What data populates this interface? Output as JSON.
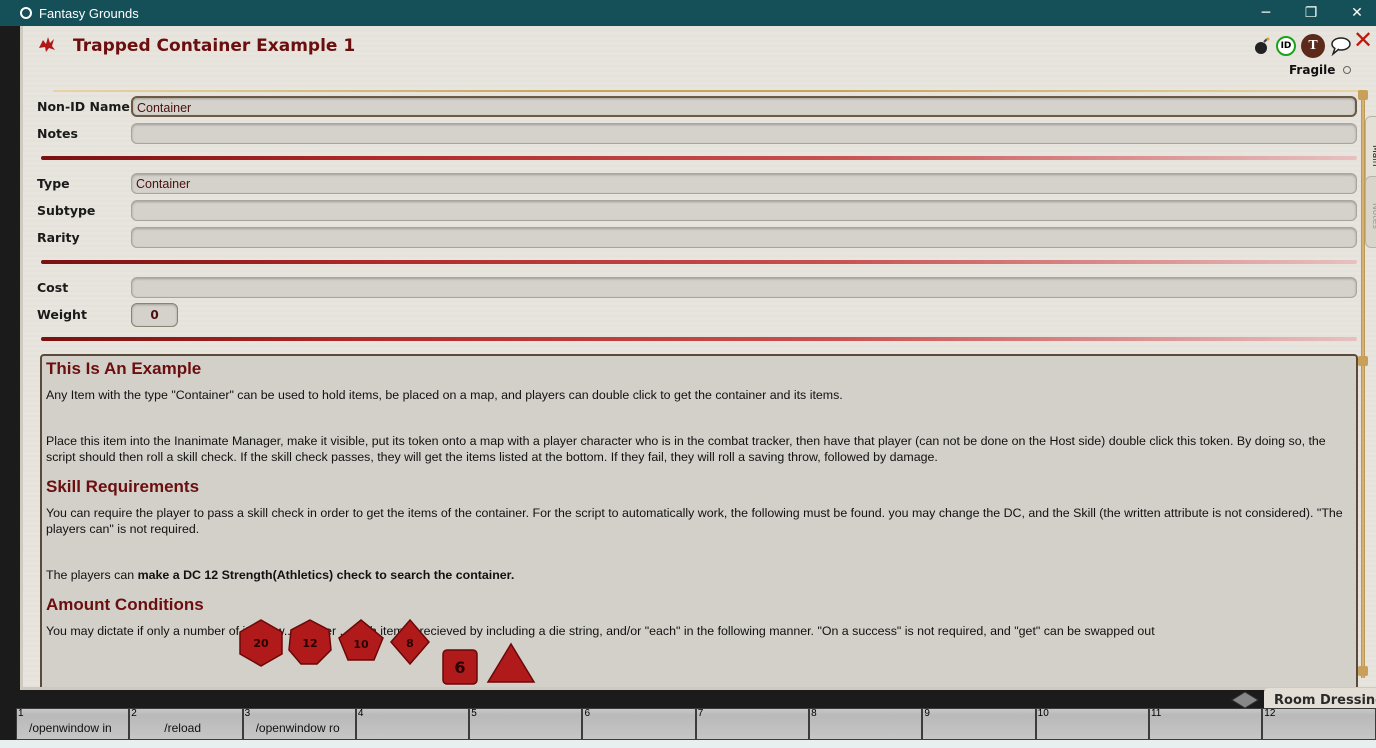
{
  "titlebar": {
    "title": "Fantasy Grounds",
    "min_glyph": "─",
    "max_glyph": "❐",
    "close_glyph": "✕"
  },
  "item": {
    "title": "Trapped Container Example 1",
    "close_glyph": "✕",
    "id_badge": "ID",
    "t_badge": "T",
    "fragile_label": "Fragile",
    "fields": {
      "nonid_label": "Non-ID Name",
      "nonid_value": "Container",
      "notes_label": "Notes",
      "notes_value": "",
      "type_label": "Type",
      "type_value": "Container",
      "subtype_label": "Subtype",
      "subtype_value": "",
      "rarity_label": "Rarity",
      "rarity_value": "",
      "cost_label": "Cost",
      "cost_value": "",
      "weight_label": "Weight",
      "weight_value": "0"
    },
    "tabs": {
      "main": "Main",
      "notes": "Notes"
    },
    "description": {
      "h1": "This Is An Example",
      "p1": "Any Item with the type \"Container\" can be used to hold items, be placed on a map, and players can double click to get the container and its items.",
      "p2": "Place this item into the Inanimate Manager, make it visible, put its token onto a map with a player character who is in the combat tracker, then have that player (can not be done on the Host side) double click this token. By doing so, the script should then roll a skill check. If the skill check passes, they will get the items listed at the bottom. If they fail, they will roll a saving throw, followed by damage.",
      "h2": "Skill Requirements",
      "p3": "You can require the player to pass a skill check in order to get the items of the container. For the script to automatically work, the following must be found. you may change the DC, and the Skill (the written attribute is not considered). \"The players can\" is not required.",
      "p4_plain": "The players can ",
      "p4_bold": "make a DC 12 Strength(Athletics) check to search the container.",
      "h3": "Amount Conditions",
      "p5": "You may dictate if only a number of items w... ...mber ...each item is recieved by including a die string, and/or \"each\" in the following manner. \"On a success\" is not required, and \"get\" can be swapped out"
    }
  },
  "dice": [
    "20",
    "12",
    "10",
    "8",
    "6",
    "4"
  ],
  "colors": {
    "title_red": "#6b0e0e",
    "die_red": "#b01a1a",
    "titlebar_teal": "#154f58"
  },
  "room_dressing": "Room Dressing",
  "hotkeys": [
    {
      "num": "1",
      "label": "/openwindow in"
    },
    {
      "num": "2",
      "label": "/reload"
    },
    {
      "num": "3",
      "label": "/openwindow ro"
    },
    {
      "num": "4",
      "label": ""
    },
    {
      "num": "5",
      "label": ""
    },
    {
      "num": "6",
      "label": ""
    },
    {
      "num": "7",
      "label": ""
    },
    {
      "num": "8",
      "label": ""
    },
    {
      "num": "9",
      "label": ""
    },
    {
      "num": "10",
      "label": ""
    },
    {
      "num": "11",
      "label": ""
    },
    {
      "num": "12",
      "label": ""
    }
  ]
}
